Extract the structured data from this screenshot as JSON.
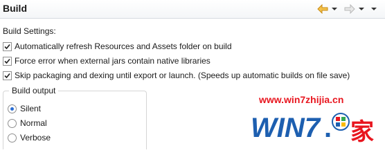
{
  "header": {
    "title": "Build",
    "back_icon": "arrow-left-icon",
    "forward_icon": "arrow-right-icon"
  },
  "build_settings": {
    "label": "Build Settings:",
    "options": [
      {
        "label": "Automatically refresh Resources and Assets folder on build",
        "checked": true
      },
      {
        "label": "Force error when external jars contain native libraries",
        "checked": true
      },
      {
        "label": "Skip packaging and dexing until export or launch. (Speeds up automatic builds on file save)",
        "checked": true
      }
    ]
  },
  "build_output": {
    "label": "Build output",
    "options": [
      {
        "label": "Silent",
        "checked": true
      },
      {
        "label": "Normal",
        "checked": false
      },
      {
        "label": "Verbose",
        "checked": false
      }
    ]
  },
  "watermark": {
    "url": "www.win7zhijia.cn",
    "logo_text": "WIN7.家"
  },
  "colors": {
    "accent": "#2a6dd4",
    "nav_arrow_active": "#e8a320",
    "watermark_red": "#e8161f",
    "watermark_blue": "#1d5fb0"
  }
}
